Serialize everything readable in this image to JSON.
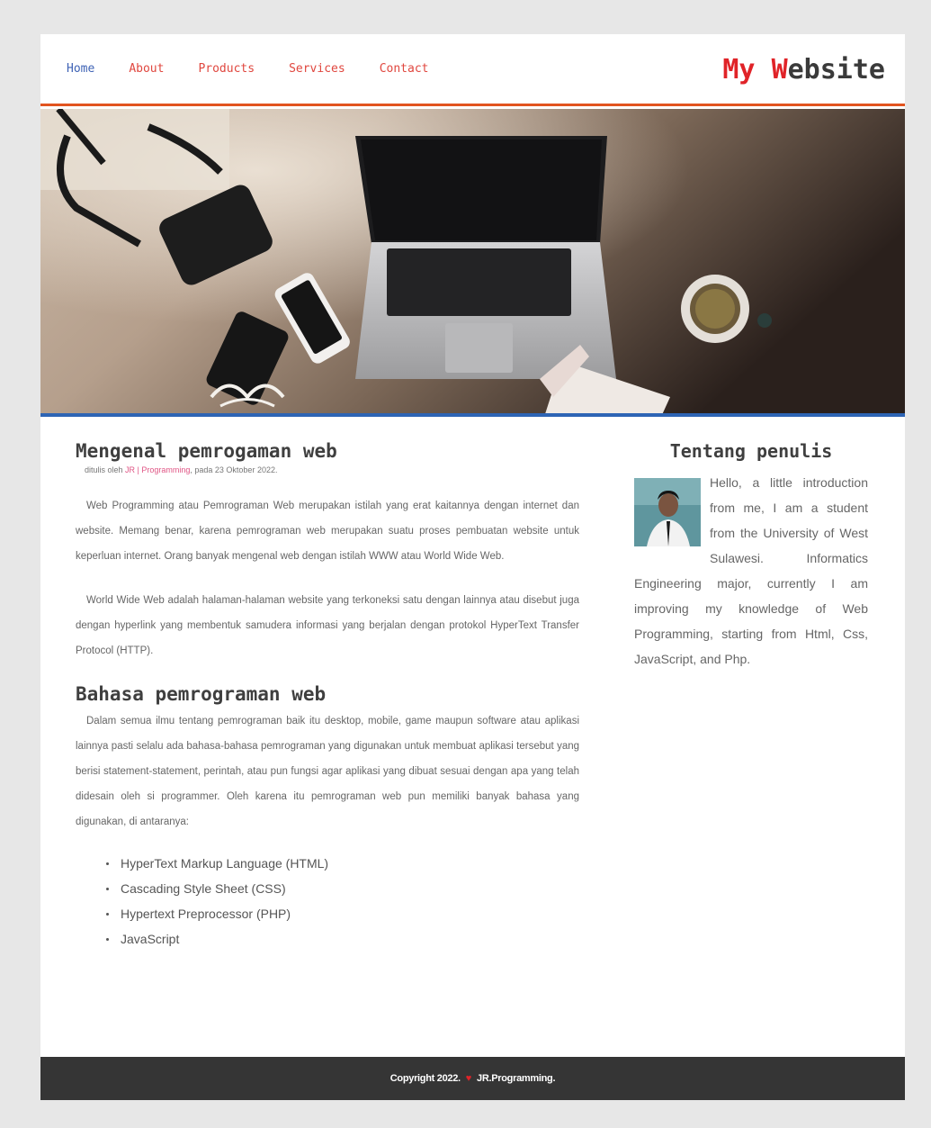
{
  "nav": {
    "items": [
      {
        "label": "Home",
        "active": true
      },
      {
        "label": "About",
        "active": false
      },
      {
        "label": "Products",
        "active": false
      },
      {
        "label": "Services",
        "active": false
      },
      {
        "label": "Contact",
        "active": false
      }
    ]
  },
  "brand": {
    "part1": "My ",
    "part2": "W",
    "part3": "ebsite"
  },
  "colors": {
    "accent_red": "#e02328",
    "nav_link": "#e0473f",
    "nav_active": "#3f63b5",
    "header_border": "#e2541f",
    "hero_border": "#2d64b4",
    "footer_bg": "#353535"
  },
  "article": {
    "title": "Mengenal pemrogaman web",
    "byline_prefix": "ditulis oleh ",
    "byline_author": "JR | Programming",
    "byline_suffix": ", pada 23 Oktober 2022.",
    "p1": "Web Programming atau Pemrograman Web merupakan istilah yang erat kaitannya dengan internet dan website. Memang benar, karena pemrograman web merupakan suatu proses pembuatan website untuk keperluan internet. Orang banyak mengenal web dengan istilah WWW atau World Wide Web.",
    "p2": "World Wide Web adalah halaman-halaman website yang terkoneksi satu dengan lainnya atau disebut juga dengan hyperlink yang membentuk samudera informasi yang berjalan dengan protokol HyperText Transfer Protocol (HTTP).",
    "subtitle": "Bahasa pemrograman web",
    "p3": "Dalam semua ilmu tentang pemrograman baik itu desktop, mobile, game maupun software atau aplikasi lainnya pasti selalu ada bahasa-bahasa pemrograman yang digunakan untuk membuat aplikasi tersebut yang berisi statement-statement, perintah, atau pun fungsi agar aplikasi yang dibuat sesuai dengan apa yang telah didesain oleh si programmer. Oleh karena itu pemrograman web pun memiliki banyak bahasa yang digunakan, di antaranya:",
    "list": [
      "HyperText Markup Language (HTML)",
      "Cascading Style Sheet (CSS)",
      "Hypertext Preprocessor (PHP)",
      "JavaScript"
    ]
  },
  "sidebar": {
    "title": "Tentang penulis",
    "bio": "Hello, a little introduction from me, I am a student from the University of West Sulawesi. Informatics Engineering major, currently I am improving my knowledge of Web Programming, starting from Html, Css, JavaScript, and Php."
  },
  "footer": {
    "text_before": "Copyright 2022.",
    "heart": "♥",
    "text_after": "JR.Programming."
  }
}
